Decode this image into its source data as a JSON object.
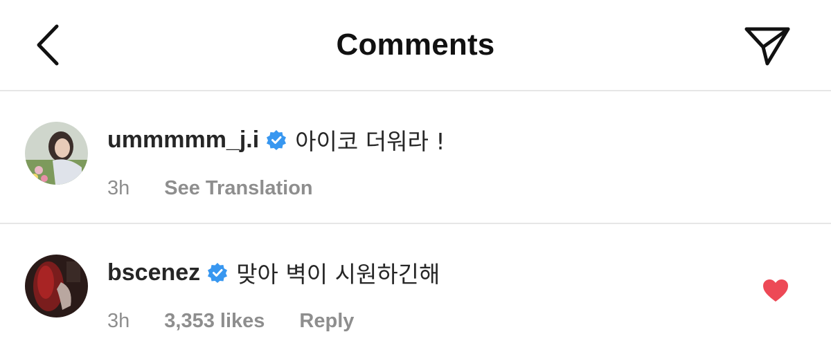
{
  "header": {
    "title": "Comments",
    "back_icon": "chevron-left-icon",
    "share_icon": "paper-plane-icon"
  },
  "comments": [
    {
      "username": "ummmmm_j.i",
      "verified": true,
      "text": "아이코 더워라 !",
      "time": "3h",
      "actions": [
        "See Translation"
      ],
      "liked": false
    },
    {
      "username": "bscenez",
      "verified": true,
      "text": "맞아 벽이 시원하긴해",
      "time": "3h",
      "likes": "3,353 likes",
      "actions": [
        "Reply"
      ],
      "liked": true
    }
  ],
  "colors": {
    "verified_blue": "#3897f0",
    "heart_red": "#ed4956",
    "meta_gray": "#8e8e8e",
    "divider": "#e6e6e6"
  }
}
